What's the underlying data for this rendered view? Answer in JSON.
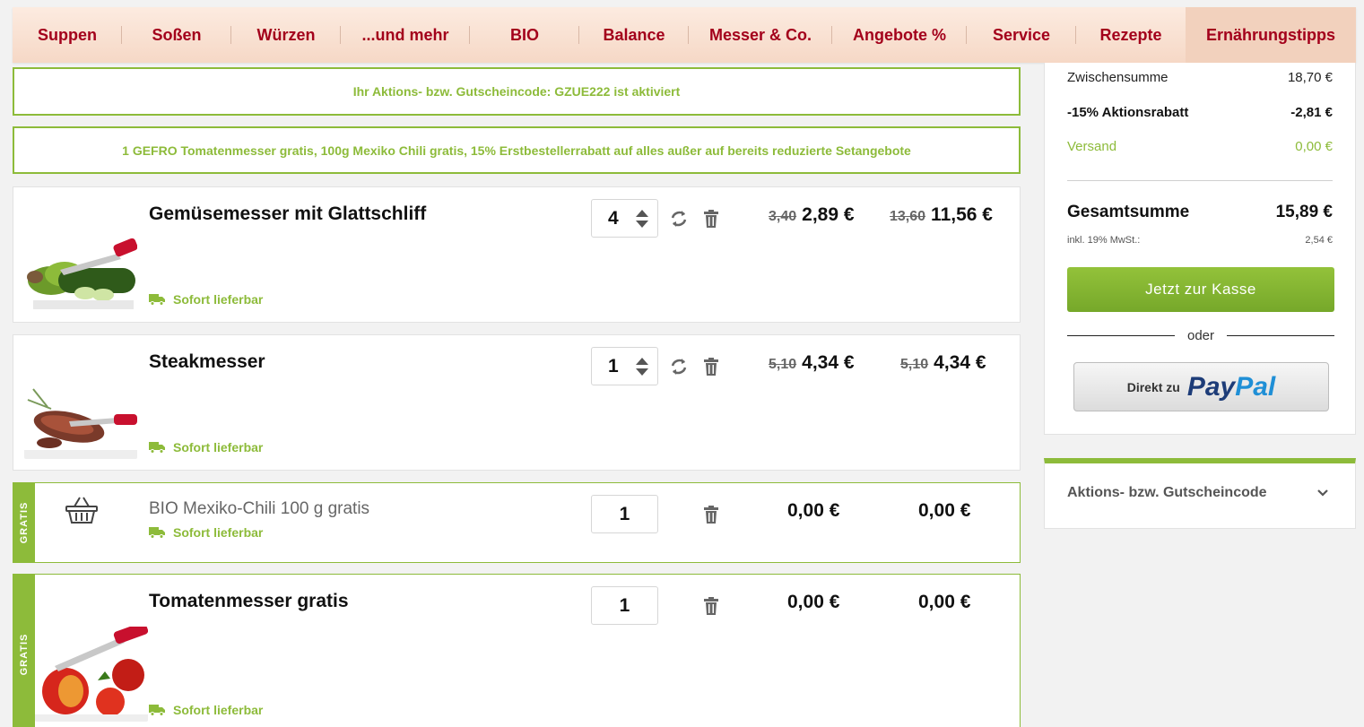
{
  "nav": {
    "items": [
      "Suppen",
      "Soßen",
      "Würzen",
      "...und mehr",
      "BIO",
      "Balance",
      "Messer & Co.",
      "Angebote %",
      "Service",
      "Rezepte",
      "Ernährungstipps"
    ],
    "active_index": 10
  },
  "promos": {
    "code_activated": "Ihr Aktions- bzw. Gutscheincode: GZUE222 ist aktiviert",
    "offer": "1 GEFRO Tomatenmesser gratis, 100g Mexiko Chili gratis, 15% Erstbestellerrabatt auf alles außer auf bereits reduzierte Setangebote"
  },
  "cart": {
    "items": [
      {
        "name": "Gemüsemesser mit Glattschliff",
        "delivery": "Sofort lieferbar",
        "qty": "4",
        "unit_old": "3,40",
        "unit_price": "2,89 €",
        "total_old": "13,60",
        "total_price": "11,56 €"
      },
      {
        "name": "Steakmesser",
        "delivery": "Sofort lieferbar",
        "qty": "1",
        "unit_old": "5,10",
        "unit_price": "4,34 €",
        "total_old": "5,10",
        "total_price": "4,34 €"
      },
      {
        "name": "BIO Mexiko-Chili 100 g gratis",
        "delivery": "Sofort lieferbar",
        "qty": "1",
        "unit_price": "0,00 €",
        "total_price": "0,00 €",
        "badge": "GRATIS"
      },
      {
        "name": "Tomatenmesser gratis",
        "delivery": "Sofort lieferbar",
        "qty": "1",
        "unit_price": "0,00 €",
        "total_price": "0,00 €",
        "badge": "GRATIS"
      }
    ]
  },
  "summary": {
    "subtotal_label": "Zwischensumme",
    "subtotal_value": "18,70 €",
    "discount_label": "-15% Aktionsrabatt",
    "discount_value": "-2,81 €",
    "shipping_label": "Versand",
    "shipping_value": "0,00 €",
    "total_label": "Gesamtsumme",
    "total_value": "15,89 €",
    "vat_label": "inkl. 19% MwSt.:",
    "vat_value": "2,54 €",
    "checkout_label": "Jetzt zur Kasse",
    "or_label": "oder",
    "paypal_prefix": "Direkt zu",
    "paypal_brand_1": "Pay",
    "paypal_brand_2": "Pal"
  },
  "voucher": {
    "label": "Aktions- bzw. Gutscheincode"
  },
  "colors": {
    "brand_red": "#a3001b",
    "accent_green": "#8dbb3a"
  }
}
